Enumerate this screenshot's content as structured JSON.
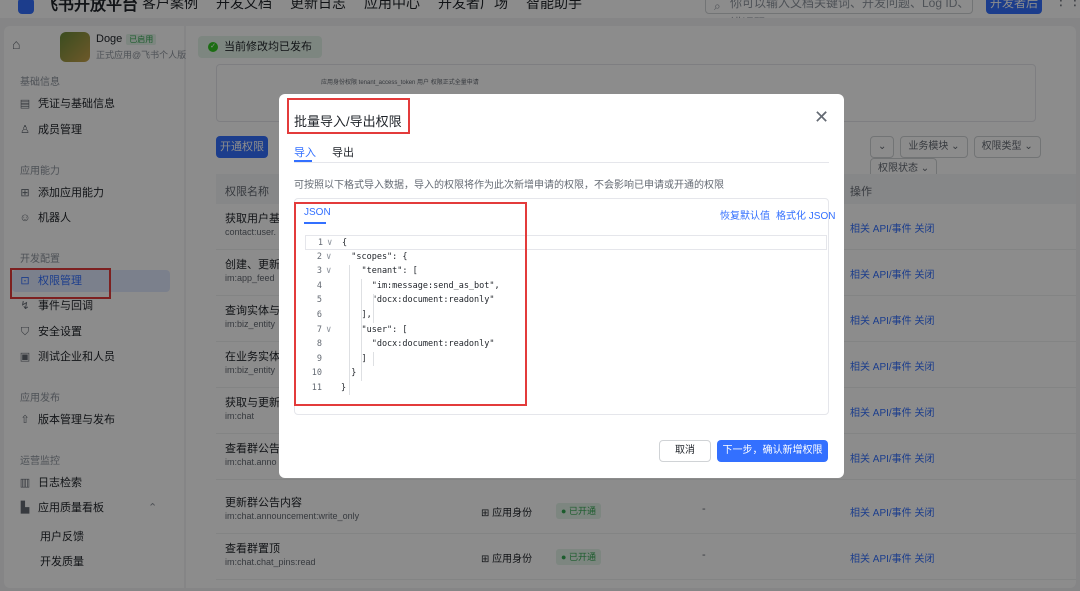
{
  "topbar": {
    "logo": "飞书开放平台",
    "nav": [
      "客户案例",
      "开发文档",
      "更新日志",
      "应用中心",
      "开发者广场",
      "智能助手"
    ],
    "search_placeholder": "你可以输入文档关键词、开发问题、Log ID、错误码",
    "dev_console": "开发者后台"
  },
  "app": {
    "name": "Doge",
    "tag": "已启用",
    "subtitle": "正式应用@飞书个人版"
  },
  "sidebar": {
    "sections": [
      {
        "title": "基础信息",
        "items": [
          {
            "icon": "document-icon",
            "glyph": "▤",
            "label": "凭证与基础信息"
          },
          {
            "icon": "person-icon",
            "glyph": "♙",
            "label": "成员管理"
          }
        ]
      },
      {
        "title": "应用能力",
        "items": [
          {
            "icon": "grid-icon",
            "glyph": "⊞",
            "label": "添加应用能力"
          },
          {
            "icon": "robot-icon",
            "glyph": "☺",
            "label": "机器人"
          }
        ]
      },
      {
        "title": "开发配置",
        "items": [
          {
            "icon": "lock-icon",
            "glyph": "⊡",
            "label": "权限管理"
          },
          {
            "icon": "event-icon",
            "glyph": "↯",
            "label": "事件与回调"
          },
          {
            "icon": "shield-icon",
            "glyph": "⛉",
            "label": "安全设置"
          },
          {
            "icon": "test-icon",
            "glyph": "▣",
            "label": "测试企业和人员"
          }
        ]
      },
      {
        "title": "应用发布",
        "items": [
          {
            "icon": "upload-icon",
            "glyph": "⇧",
            "label": "版本管理与发布"
          }
        ]
      },
      {
        "title": "运营监控",
        "items": [
          {
            "icon": "log-icon",
            "glyph": "▥",
            "label": "日志检索"
          },
          {
            "icon": "chart-icon",
            "glyph": "▙",
            "label": "应用质量看板"
          }
        ]
      }
    ],
    "sub_items": [
      "用户反馈",
      "开发质量"
    ]
  },
  "main": {
    "status": "当前修改均已发布",
    "strip_text": "应用身份权限 tenant_access_token 用户  权限正式全量申请",
    "open_button": "开通权限",
    "filters": [
      "业务模块",
      "权限类型",
      "权限状态"
    ],
    "table_headers": [
      "权限名称",
      "操作"
    ],
    "rows": [
      {
        "name": "获取用户基本",
        "code": "contact:user.",
        "ident": "",
        "status": "",
        "dash": "",
        "action": "相关 API/事件  关闭"
      },
      {
        "name": "创建、更新、",
        "code": "im:app_feed",
        "ident": "",
        "status": "",
        "dash": "",
        "action": "相关 API/事件  关闭"
      },
      {
        "name": "查询实体与标",
        "code": "im:biz_entity",
        "ident": "",
        "status": "",
        "dash": "",
        "action": "相关 API/事件  关闭"
      },
      {
        "name": "在业务实体上",
        "code": "im:biz_entity",
        "ident": "",
        "status": "",
        "dash": "",
        "action": "相关 API/事件  关闭"
      },
      {
        "name": "获取与更新群",
        "code": "im:chat",
        "ident": "",
        "status": "",
        "dash": "",
        "action": "相关 API/事件  关闭"
      },
      {
        "name": "查看群公告信",
        "code": "im:chat.anno",
        "ident": "",
        "status": "",
        "dash": "",
        "action": "相关 API/事件  关闭"
      },
      {
        "name": "更新群公告内容",
        "code": "im:chat.announcement:write_only",
        "ident": "应用身份",
        "status": "已开通",
        "dash": "-",
        "action": "相关 API/事件  关闭"
      },
      {
        "name": "查看群置顶",
        "code": "im:chat.chat_pins:read",
        "ident": "应用身份",
        "status": "已开通",
        "dash": "-",
        "action": "相关 API/事件  关闭"
      }
    ]
  },
  "modal": {
    "title": "批量导入/导出权限",
    "tabs": [
      "导入",
      "导出"
    ],
    "hint": "可按照以下格式导入数据，导入的权限将作为此次新增申请的权限，不会影响已申请或开通的权限",
    "editor_tab": "JSON",
    "editor_actions": [
      "恢复默认值",
      "格式化 JSON"
    ],
    "code_lines": [
      {
        "n": "1",
        "fold": "∨",
        "text": "{"
      },
      {
        "n": "2",
        "fold": "∨",
        "text": "  \"scopes\": {"
      },
      {
        "n": "3",
        "fold": "∨",
        "text": "    \"tenant\": ["
      },
      {
        "n": "4",
        "fold": "",
        "text": "      \"im:message:send_as_bot\","
      },
      {
        "n": "5",
        "fold": "",
        "text": "      \"docx:document:readonly\""
      },
      {
        "n": "6",
        "fold": "",
        "text": "    ],"
      },
      {
        "n": "7",
        "fold": "∨",
        "text": "    \"user\": ["
      },
      {
        "n": "8",
        "fold": "",
        "text": "      \"docx:document:readonly\""
      },
      {
        "n": "9",
        "fold": "",
        "text": "    ]"
      },
      {
        "n": "10",
        "fold": "",
        "text": "  }"
      },
      {
        "n": "11",
        "fold": "",
        "text": "}"
      }
    ],
    "cancel": "取消",
    "next": "下一步，确认新增权限"
  }
}
